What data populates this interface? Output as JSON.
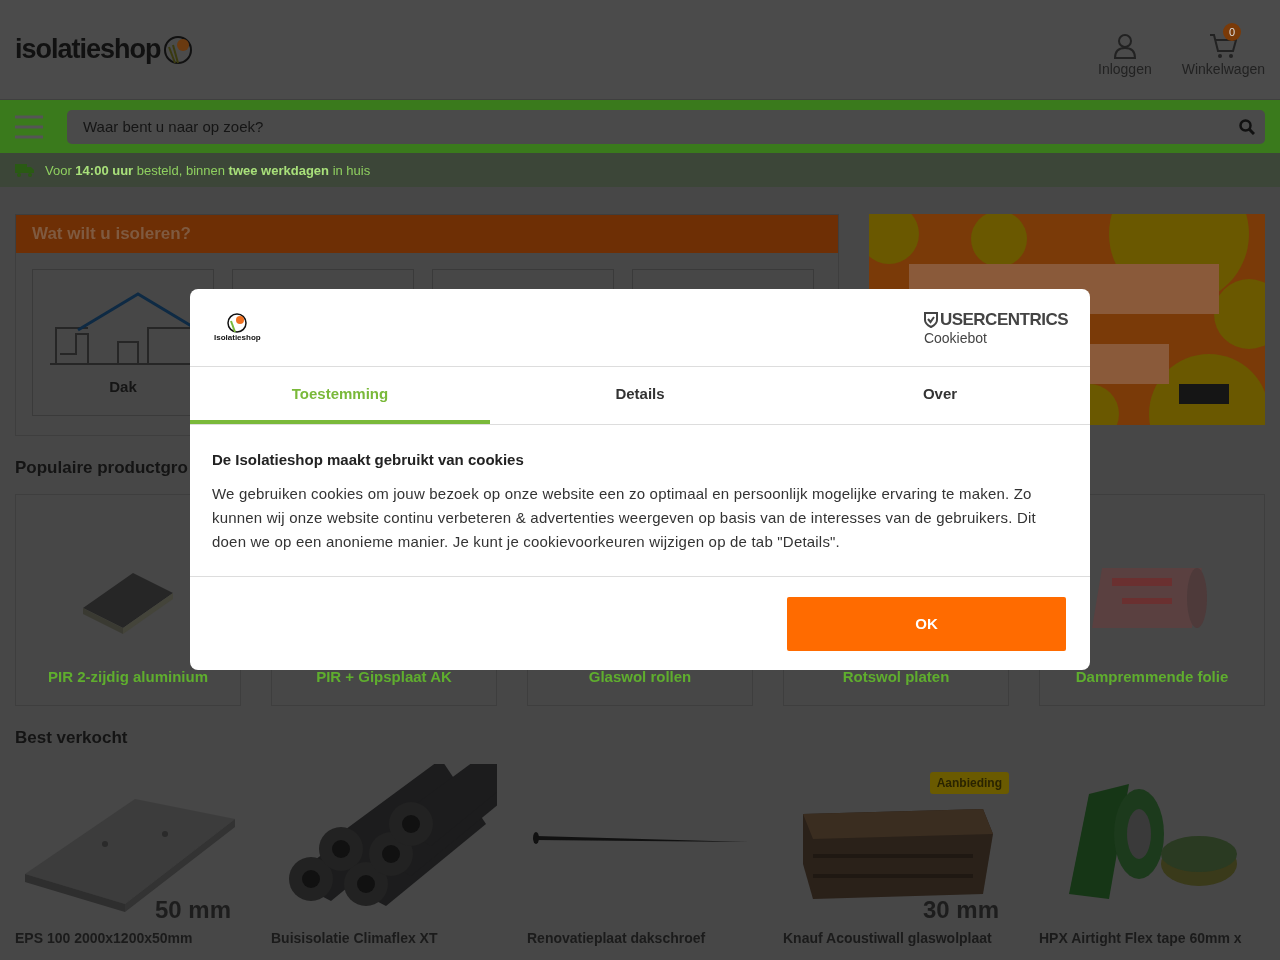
{
  "header": {
    "logo": "isolatieshop",
    "login": "Inloggen",
    "cart": {
      "label": "Winkelwagen",
      "count": "0"
    }
  },
  "nav": {
    "search": {
      "placeholder": "Waar bent u naar op zoek?"
    }
  },
  "usp": "Voor **14:00 uur** besteld, binnen **twee werkdagen** in huis",
  "categories": {
    "title": "Wat wilt u isoleren?",
    "tiles": [
      {
        "kind": "house",
        "label": "Dak"
      },
      {
        "kind": "blank"
      },
      {
        "kind": "blank"
      },
      {
        "kind": "blank"
      }
    ]
  },
  "popular": {
    "title": "Populaire productgro",
    "items": [
      {
        "label": "PIR 2-zijdig aluminium",
        "kind": "board"
      },
      {
        "label": "PIR + Gipsplaat AK"
      },
      {
        "label": "Glaswol rollen"
      },
      {
        "label": "Rotswol platen"
      },
      {
        "label": "Dampremmende folie",
        "kind": "roll"
      }
    ]
  },
  "bestsellers": {
    "title": "Best verkocht",
    "items": [
      {
        "name": "EPS 100 2000x1200x50mm",
        "kind": "slab",
        "size": "50 mm"
      },
      {
        "name": "Buisisolatie Climaflex XT",
        "kind": "tubes"
      },
      {
        "name": "Renovatieplaat dakschroef",
        "kind": "screw"
      },
      {
        "name": "Knauf Acoustiwall glaswolplaat",
        "kind": "wool",
        "size": "30 mm",
        "badge": "Aanbieding"
      },
      {
        "name": "HPX Airtight Flex tape 60mm x",
        "kind": "tape"
      }
    ]
  },
  "cookie_dialog": {
    "brand_logo": "Isolatieshop",
    "provider": {
      "name": "USERCENTRICS",
      "product": "Cookiebot"
    },
    "tabs": [
      {
        "label": "Toestemming",
        "selected": true
      },
      {
        "label": "Details",
        "selected": false
      },
      {
        "label": "Over",
        "selected": false
      }
    ],
    "title": "De Isolatieshop maakt gebruikt van cookies",
    "text": "We gebruiken cookies om jouw bezoek op onze website een zo optimaal en persoonlijk mogelijke ervaring te maken. Zo kunnen wij onze website continu verbeteren & advertenties weergeven op basis van de interesses van de gebruikers. Dit doen we op een anonieme manier. Je kunt je cookievoorkeuren wijzigen op de tab \"Details\".",
    "button": "OK"
  }
}
